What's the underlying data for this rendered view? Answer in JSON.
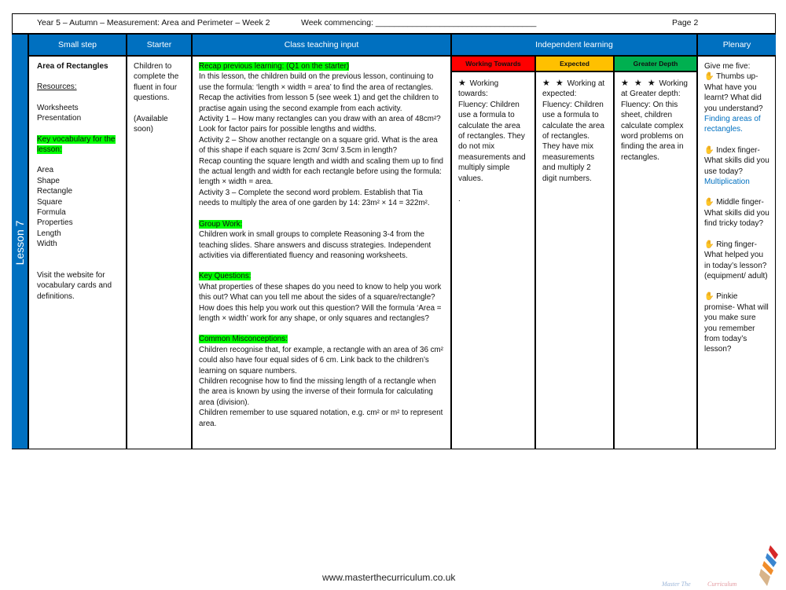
{
  "header": {
    "title": "Year 5 – Autumn – Measurement: Area and Perimeter – Week 2",
    "week_commencing": "Week commencing: ___________________________________",
    "page": "Page 2"
  },
  "columns": {
    "small_step": "Small step",
    "starter": "Starter",
    "class_teaching": "Class teaching input",
    "independent": "Independent learning",
    "plenary": "Plenary"
  },
  "lesson": "Lesson 7",
  "small_step": {
    "title": "Area of Rectangles",
    "resources_label": "Resources:",
    "resources": [
      "Worksheets",
      "Presentation"
    ],
    "vocab_label": "Key vocabulary for the lesson:",
    "vocab": [
      "Area",
      "Shape",
      "Rectangle",
      "Square",
      "Formula",
      "Properties",
      "Length",
      "Width"
    ],
    "note": "Visit the website for vocabulary cards and definitions."
  },
  "starter": {
    "text": "Children to complete the fluent in four questions.",
    "note": "(Available soon)"
  },
  "teaching": {
    "recap_label": "Recap previous learning: (Q1 on the starter)",
    "recap": [
      "In this lesson, the children build on the previous lesson, continuing to use the formula: ‘length × width = area’ to find the area of rectangles.",
      "Recap the activities from lesson 5 (see week 1) and get the children to practise again using the second example from each activity.",
      "Activity 1 – How many rectangles can you draw with an area of 48cm²? Look for factor pairs for possible lengths and widths.",
      "Activity 2 – Show another rectangle on a square grid. What is the area of this shape if each square is 2cm/ 3cm/ 3.5cm in length?",
      "Recap counting the square length and width and scaling them up to find the actual length and width for each rectangle before using the formula: length × width = area.",
      "Activity 3 – Complete the second word problem. Establish that Tia needs to multiply the area of one garden by 14: 23m² × 14 = 322m²."
    ],
    "group_label": "Group Work:",
    "group": "Children work in small groups to complete Reasoning 3-4 from the teaching slides. Share answers and discuss strategies. Independent activities via differentiated fluency and reasoning worksheets.",
    "questions_label": "Key Questions:",
    "questions": "What properties of these shapes do you need to know to help you work this out? What can you tell me about the sides of a square/rectangle? How does this help you work out this question? Will the formula ‘Area = length × width’ work for any shape, or only squares and rectangles?",
    "misconceptions_label": "Common Misconceptions:",
    "misconceptions": [
      "Children recognise that, for example, a rectangle with an area of 36 cm² could also have four equal sides of 6 cm. Link back to the children’s learning on square numbers.",
      "Children recognise how to find the missing length of a rectangle when the area is known by using the inverse of their formula for calculating area (division).",
      "Children remember to use squared notation, e.g. cm² or m² to represent area."
    ]
  },
  "independent": [
    {
      "label": "Working Towards",
      "color": "#ff0000",
      "stars": "★",
      "heading": "Working towards:",
      "text": "Fluency: Children use a formula to calculate the area of rectangles. They do not mix measurements and multiply simple values.",
      "extra": "."
    },
    {
      "label": "Expected",
      "color": "#ffc000",
      "stars": "★ ★",
      "heading": "Working at expected:",
      "text": "Fluency: Children use a formula to calculate the area of rectangles. They have mix measurements and multiply 2 digit numbers.",
      "extra": ""
    },
    {
      "label": "Greater Depth",
      "color": "#00b050",
      "stars": "★ ★ ★",
      "heading": "Working at Greater depth:",
      "text": "Fluency: On this sheet, children calculate complex word problems on finding the area in rectangles.",
      "extra": ""
    }
  ],
  "plenary": {
    "intro": "Give me five:",
    "items": [
      {
        "text": "Thumbs up- What have you learnt? What did you understand?",
        "answer": "Finding areas of rectangles."
      },
      {
        "text": "Index finger- What skills did you use today?",
        "answer": "Multiplication"
      },
      {
        "text": "Middle finger- What skills did you find tricky today?",
        "answer": ""
      },
      {
        "text": "Ring finger- What helped you in today’s lesson? (equipment/ adult)",
        "answer": ""
      },
      {
        "text": "Pinkie promise- What will you make sure you remember from today’s lesson?",
        "answer": ""
      }
    ]
  },
  "footer": {
    "url": "www.masterthecurriculum.co.uk",
    "logo_text": "Master The Curriculum"
  },
  "colors": {
    "header_blue": "#0070c0",
    "highlight": "#00ff00",
    "answer_blue": "#0070c0"
  }
}
